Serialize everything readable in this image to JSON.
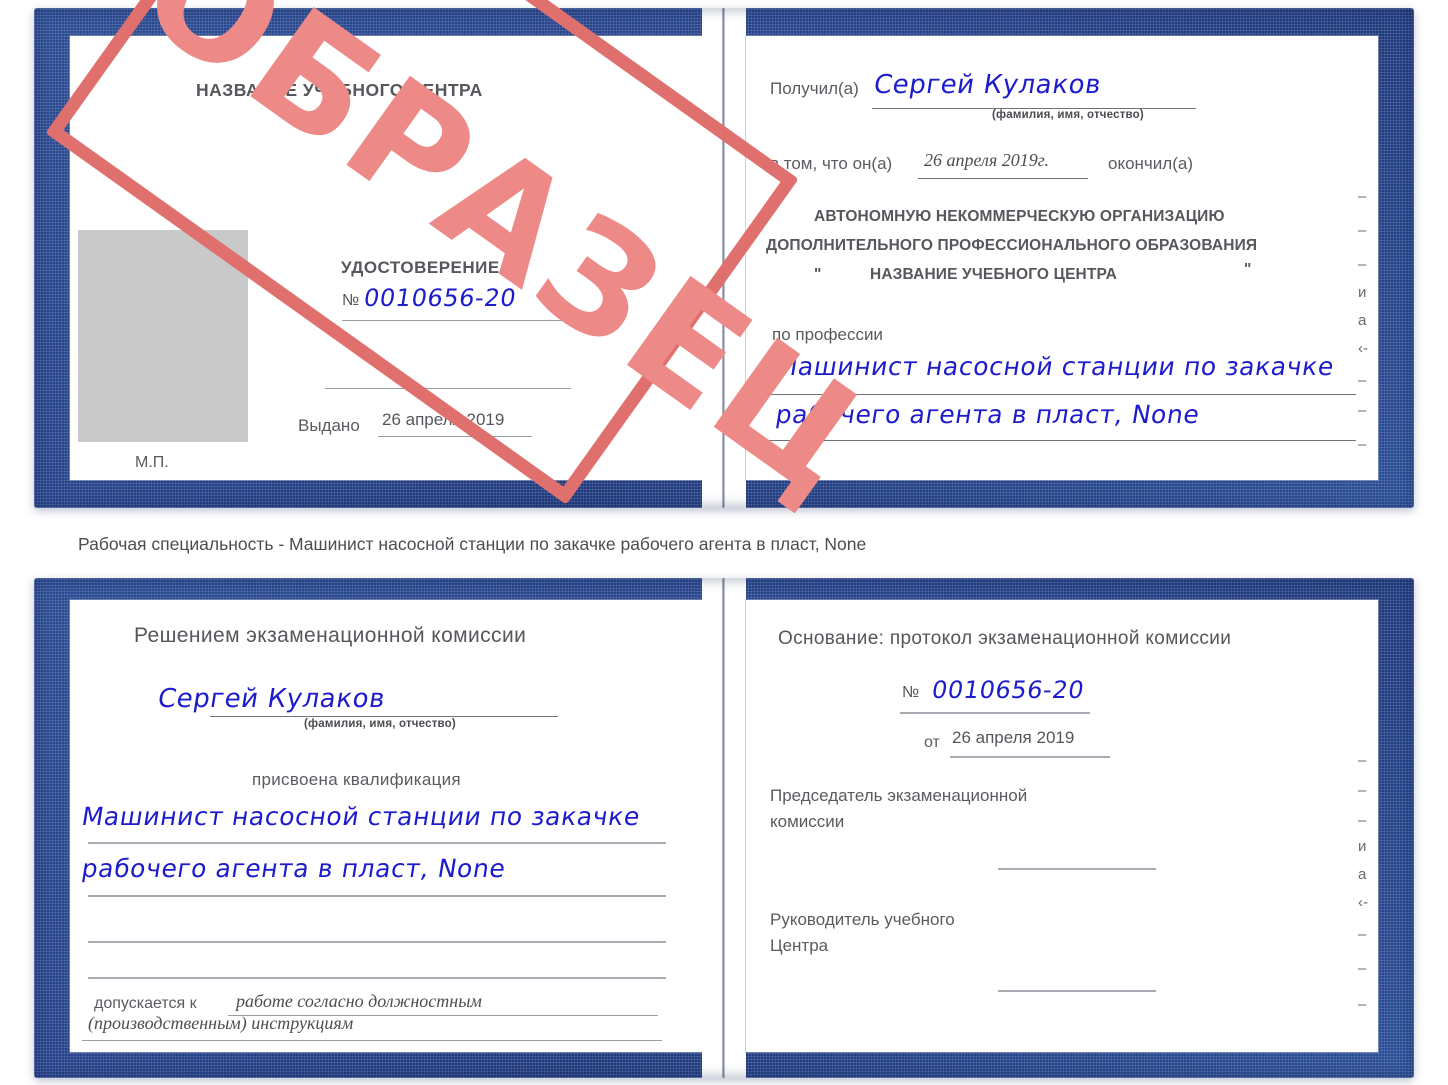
{
  "colors": {
    "cover_blue": "#26428a",
    "ink_blue": "#1c1ccd",
    "stamp_red": "#e0706d",
    "text_gray": "#58595e"
  },
  "watermark": {
    "text": "ОБРАЗЕЦ"
  },
  "caption": {
    "text": "Рабочая специальность - Машинист насосной станции по закачке рабочего агента в пласт, None"
  },
  "top_certificate": {
    "left_page": {
      "center_name": "НАЗВАНИЕ УЧЕБНОГО ЦЕНТРА",
      "doc_title": "УДОСТОВЕРЕНИЕ",
      "number_symbol": "№",
      "number_value": "0010656-20",
      "issued_label": "Выдано",
      "issued_value": "26 апреля 2019",
      "seal_label": "М.П."
    },
    "right_page": {
      "received_label": "Получил(а)",
      "received_value": "Сергей Кулаков",
      "fio_hint": "(фамилия, имя, отчество)",
      "in_that_label": "в том, что он(а)",
      "completion_date": "26 апреля 2019г.",
      "finished_label": "окончил(а)",
      "org_line1": "АВТОНОМНУЮ НЕКОММЕРЧЕСКУЮ ОРГАНИЗАЦИЮ",
      "org_line2": "ДОПОЛНИТЕЛЬНОГО ПРОФЕССИОНАЛЬНОГО ОБРАЗОВАНИЯ",
      "org_quote_open": "\"",
      "org_line3": "НАЗВАНИЕ УЧЕБНОГО ЦЕНТРА",
      "org_quote_close": "\"",
      "profession_label": "по профессии",
      "profession_line1": "Машинист насосной станции по закачке",
      "profession_line2": "рабочего агента в пласт, None",
      "margin_fragments": [
        "–",
        "–",
        "–",
        "и",
        "а",
        "‹-",
        "–",
        "–",
        "–"
      ]
    }
  },
  "bottom_certificate": {
    "left_page": {
      "heading": "Решением экзаменационной комиссии",
      "name_value": "Сергей Кулаков",
      "fio_hint": "(фамилия, имя, отчество)",
      "qualification_label": "присвоена квалификация",
      "qualification_line1": "Машинист насосной станции по закачке",
      "qualification_line2": "рабочего агента в пласт, None",
      "admitted_label": "допускается к",
      "admitted_line1": "работе согласно должностным",
      "admitted_line2": "(производственным) инструкциям"
    },
    "right_page": {
      "basis_label": "Основание: протокол экзаменационной комиссии",
      "number_symbol": "№",
      "number_value": "0010656-20",
      "from_label": "от",
      "from_value": "26 апреля 2019",
      "chairman_line1": "Председатель экзаменационной",
      "chairman_line2": "комиссии",
      "head_line1": "Руководитель учебного",
      "head_line2": "Центра",
      "margin_fragments": [
        "–",
        "–",
        "–",
        "и",
        "а",
        "‹-",
        "–",
        "–",
        "–"
      ]
    }
  }
}
